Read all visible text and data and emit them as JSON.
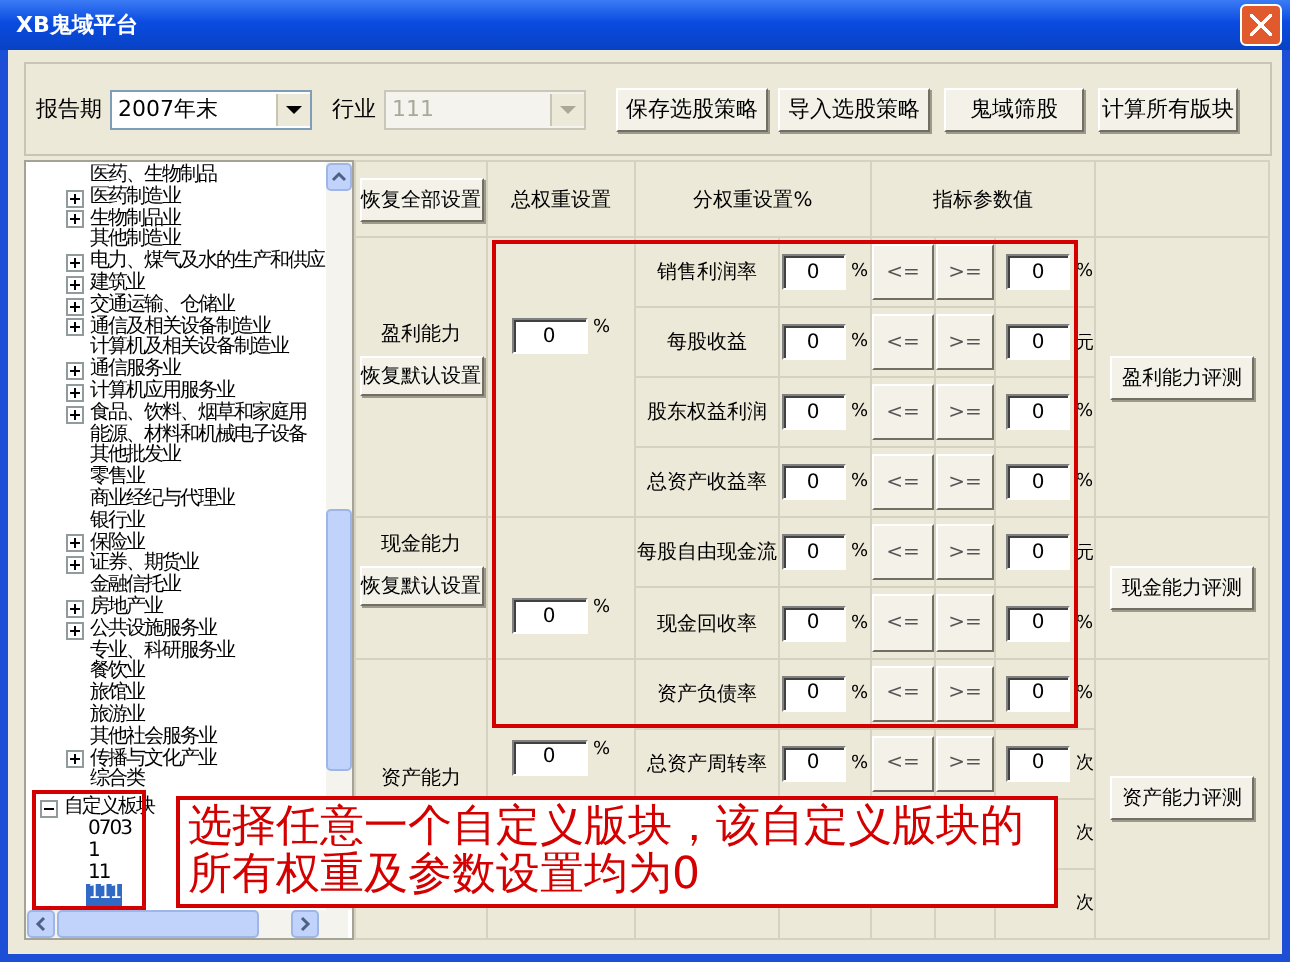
{
  "window": {
    "title": "XB鬼域平台"
  },
  "toolbar": {
    "period_label": "报告期",
    "period": "2007年末",
    "industry_label": "行业",
    "industry": {
      "value": "111",
      "disabled": true
    },
    "buttons": [
      "保存选股策略",
      "导入选股策略",
      "鬼域筛股",
      "计算所有版块"
    ]
  },
  "tree": {
    "continued_items": [
      {
        "label": "医药、生物制品"
      },
      {
        "label": "医药制造业",
        "expanded": false
      },
      {
        "label": "生物制品业",
        "expanded": false
      },
      {
        "label": "其他制造业"
      },
      {
        "label": "电力、煤气及水的生产和供应",
        "expanded": false
      },
      {
        "label": "建筑业",
        "expanded": false
      },
      {
        "label": "交通运输、仓储业",
        "expanded": false
      },
      {
        "label": "通信及相关设备制造业",
        "expanded": false
      },
      {
        "label": "计算机及相关设备制造业"
      },
      {
        "label": "通信服务业",
        "expanded": false
      },
      {
        "label": "计算机应用服务业",
        "expanded": false
      },
      {
        "label": "食品、饮料、烟草和家庭用",
        "expanded": false
      },
      {
        "label": "能源、材料和机械电子设备"
      },
      {
        "label": "其他批发业"
      },
      {
        "label": "零售业"
      },
      {
        "label": "商业经纪与代理业"
      },
      {
        "label": "银行业"
      },
      {
        "label": "保险业",
        "expanded": false
      },
      {
        "label": "证券、期货业",
        "expanded": false
      },
      {
        "label": "金融信托业"
      },
      {
        "label": "房地产业",
        "expanded": false
      },
      {
        "label": "公共设施服务业",
        "expanded": false
      },
      {
        "label": "专业、科研服务业"
      },
      {
        "label": "餐饮业"
      },
      {
        "label": "旅馆业"
      },
      {
        "label": "旅游业"
      },
      {
        "label": "其他社会服务业"
      },
      {
        "label": "传播与文化产业",
        "expanded": false
      },
      {
        "label": "综合类"
      }
    ],
    "nodes": [
      {
        "label": "自定义板块",
        "expanded": true,
        "children": [
          {
            "label": "0703",
            "selected": false
          },
          {
            "label": "1",
            "selected": false
          },
          {
            "label": "11",
            "selected": false
          },
          {
            "label": "111",
            "selected": true
          }
        ]
      }
    ]
  },
  "grid": {
    "reset_all_button": "恢复全部设置",
    "columns": [
      "总权重设置",
      "分权重设置%",
      "指标参数值"
    ],
    "groups": [
      {
        "name": "盈利能力",
        "restore_button": "恢复默认设置",
        "total_weight": "0",
        "total_unit": "%",
        "eval_button": "盈利能力评测",
        "rows": [
          {
            "label": "销售利润率",
            "weight": "0",
            "weight_unit": "%",
            "le": "<=",
            "ge": ">=",
            "value": "0",
            "value_unit": "%"
          },
          {
            "label": "每股收益",
            "weight": "0",
            "weight_unit": "%",
            "le": "<=",
            "ge": ">=",
            "value": "0",
            "value_unit": "元"
          },
          {
            "label": "股东权益利润",
            "weight": "0",
            "weight_unit": "%",
            "le": "<=",
            "ge": ">=",
            "value": "0",
            "value_unit": "%"
          },
          {
            "label": "总资产收益率",
            "weight": "0",
            "weight_unit": "%",
            "le": "<=",
            "ge": ">=",
            "value": "0",
            "value_unit": "%"
          }
        ]
      },
      {
        "name": "现金能力",
        "restore_button": "恢复默认设置",
        "total_weight": "0",
        "total_unit": "%",
        "eval_button": "现金能力评测",
        "rows": [
          {
            "label": "每股自由现金流",
            "weight": "0",
            "weight_unit": "%",
            "le": "<=",
            "ge": ">=",
            "value": "0",
            "value_unit": "元"
          },
          {
            "label": "现金回收率",
            "weight": "0",
            "weight_unit": "%",
            "le": "<=",
            "ge": ">=",
            "value": "0",
            "value_unit": "%"
          }
        ]
      },
      {
        "name": "资产能力",
        "total_weight": "0",
        "total_unit": "%",
        "eval_button": "资产能力评测",
        "rows": [
          {
            "label": "资产负债率",
            "weight": "0",
            "weight_unit": "%",
            "le": "<=",
            "ge": ">=",
            "value": "0",
            "value_unit": "%"
          },
          {
            "label": "总资产周转率",
            "weight": "0",
            "weight_unit": "%",
            "le": "<=",
            "ge": ">=",
            "value": "0",
            "value_unit": "次"
          },
          {
            "value_unit": "次"
          },
          {
            "value_unit": "次"
          }
        ]
      }
    ]
  },
  "annotation": {
    "text": "选择任意一个自定义版块，该自定义版块的所有权重及参数设置均为0"
  }
}
